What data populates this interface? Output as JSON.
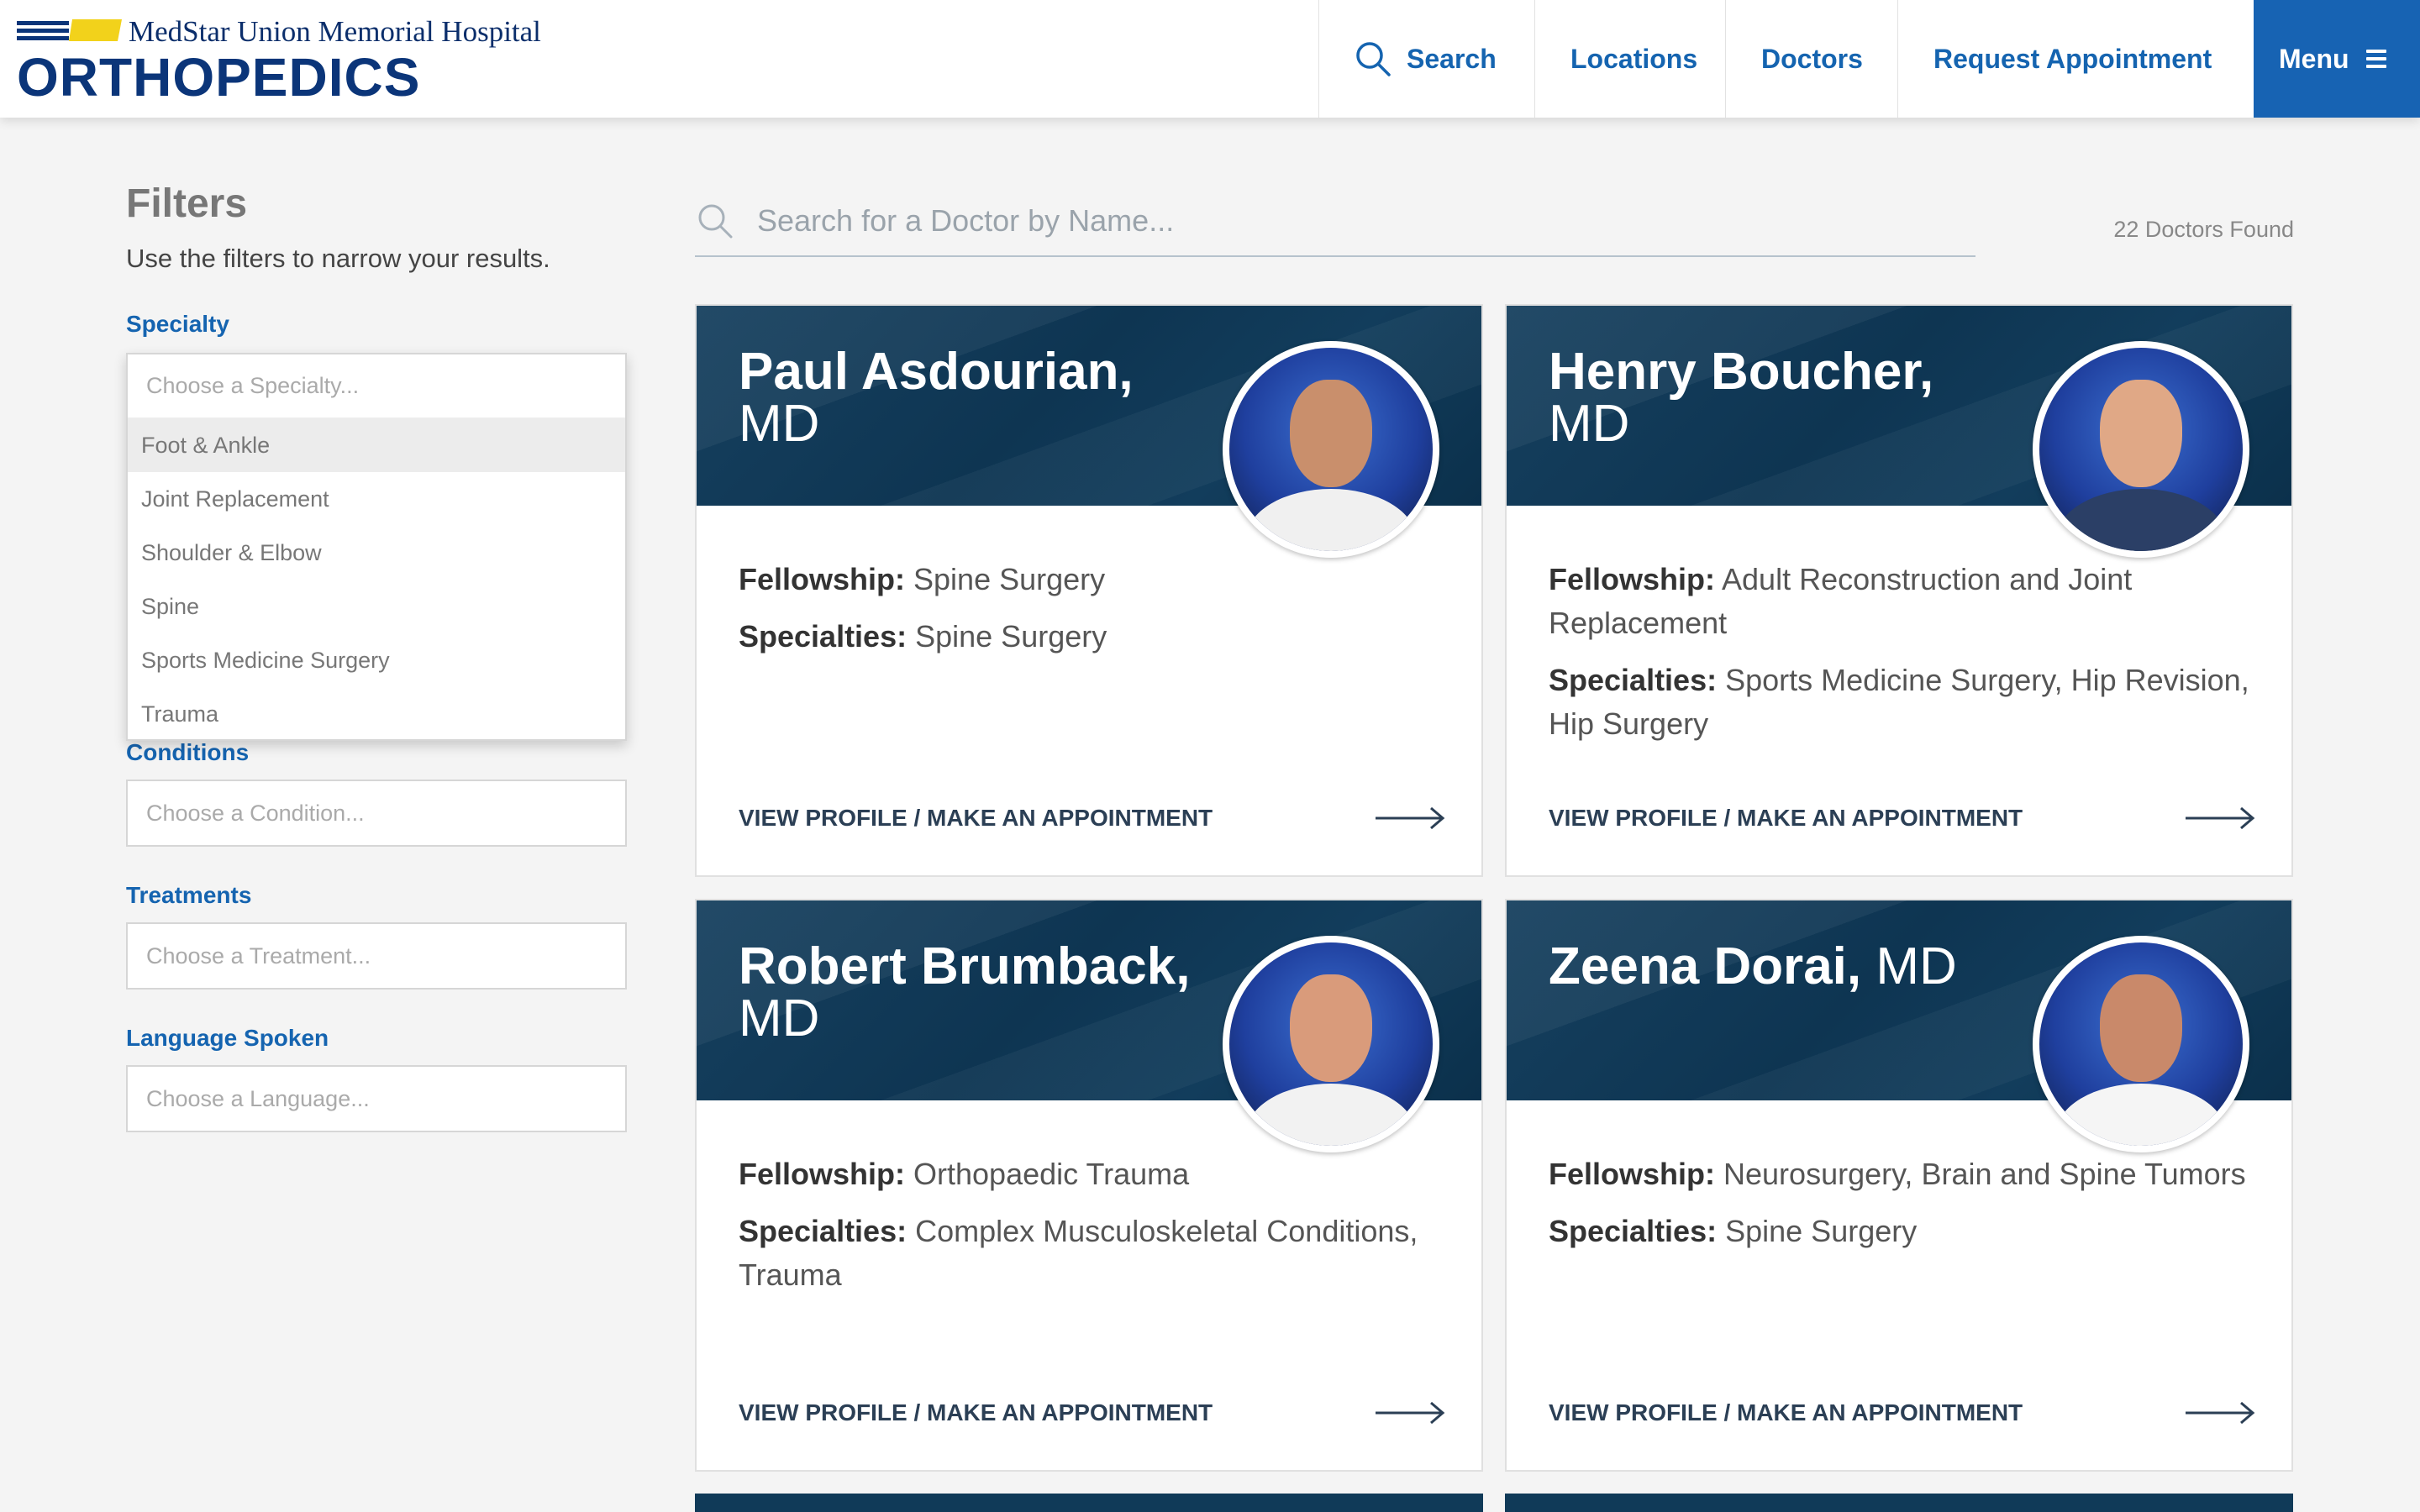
{
  "header": {
    "logo_top": "MedStar Union Memorial Hospital",
    "logo_main": "ORTHOPEDICS",
    "nav": {
      "search": "Search",
      "locations": "Locations",
      "doctors": "Doctors",
      "request": "Request Appointment",
      "menu": "Menu"
    }
  },
  "filters": {
    "title": "Filters",
    "subtitle": "Use the filters to narrow your results.",
    "specialty": {
      "label": "Specialty",
      "placeholder": "Choose a Specialty...",
      "options": [
        "Foot & Ankle",
        "Joint Replacement",
        "Shoulder & Elbow",
        "Spine",
        "Sports Medicine Surgery",
        "Trauma"
      ]
    },
    "conditions": {
      "label": "Conditions",
      "placeholder": "Choose a Condition..."
    },
    "treatments": {
      "label": "Treatments",
      "placeholder": "Choose a Treatment..."
    },
    "language": {
      "label": "Language Spoken",
      "placeholder": "Choose a Language..."
    }
  },
  "search": {
    "placeholder": "Search for a Doctor by Name...",
    "count": "22 Doctors Found"
  },
  "fellowship_label": "Fellowship:",
  "specialties_label": "Specialties:",
  "cta": "VIEW PROFILE / MAKE AN APPOINTMENT",
  "doctors": [
    {
      "name": "Paul Asdourian,",
      "cred": "MD",
      "fellowship": "Spine Surgery",
      "specialties": "Spine Surgery"
    },
    {
      "name": "Henry Boucher,",
      "cred": "MD",
      "fellowship": "Adult Reconstruction and Joint Replacement",
      "specialties": "Sports Medicine Surgery, Hip Revision, Hip Surgery"
    },
    {
      "name": "Robert Brumback,",
      "cred": "MD",
      "fellowship": "Orthopaedic Trauma",
      "specialties": "Complex Musculoskeletal Conditions, Trauma"
    },
    {
      "name": "Zeena Dorai,",
      "cred": "MD",
      "fellowship": "Neurosurgery, Brain and Spine Tumors",
      "specialties": "Spine Surgery"
    }
  ],
  "colors": {
    "brand_blue": "#1564b0",
    "menu_blue": "#1763b3",
    "card_header": "#0e3552",
    "logo_yellow": "#f2d21b"
  }
}
